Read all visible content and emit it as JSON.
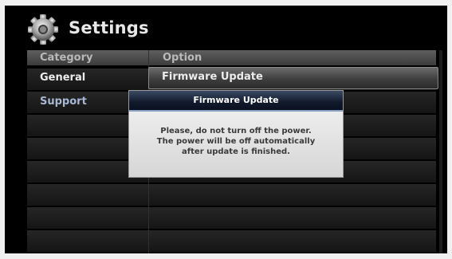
{
  "header": {
    "title": "Settings",
    "icon": "gear-icon"
  },
  "table": {
    "col_category": "Category",
    "col_option": "Option"
  },
  "categories": [
    {
      "label": "General",
      "state": "selected"
    },
    {
      "label": "Support",
      "state": "focused"
    }
  ],
  "options": [
    {
      "label": "Firmware Update",
      "state": "highlighted"
    }
  ],
  "dialog": {
    "title": "Firmware Update",
    "message_line1": "Please, do not turn off the power.",
    "message_line2": "The power will be off automatically",
    "message_line3": "after update is finished."
  },
  "colors": {
    "background": "#000000",
    "dialog_title_bg": "#111a2c",
    "support_text": "#a7b7d4"
  }
}
